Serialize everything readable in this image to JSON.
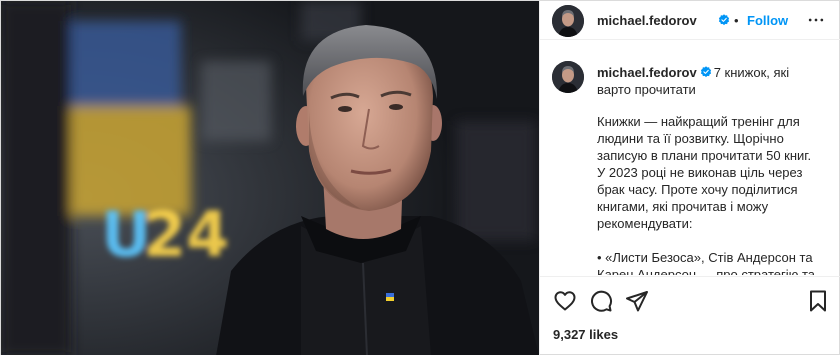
{
  "post": {
    "username": "michael.fedorov",
    "separator": "•",
    "follow_label": "Follow",
    "photo_sign": "U24"
  },
  "caption": {
    "username": "michael.fedorov",
    "title": "7 книжок, які варто прочитати",
    "paragraph": "Книжки — найкращий тренінг для людини та її розвитку. Щорічно записую в плани прочитати 50 книг. У 2023 році не виконав ціль через брак часу. Проте хочу поділитися книгами, які прочитав і можу рекомендувати:",
    "list_item": "• «Листи Безоса», Стів Андерсон та Карен Андерсон — про стратегію та"
  },
  "actions": {
    "likes": "9,327 likes"
  },
  "colors": {
    "accent": "#0095f6",
    "verified": "#0095f6",
    "text": "#262626",
    "border": "#dbdbdb"
  },
  "icons": [
    "verified-badge-icon",
    "more-options-icon",
    "heart-icon",
    "comment-icon",
    "share-icon",
    "bookmark-icon"
  ]
}
